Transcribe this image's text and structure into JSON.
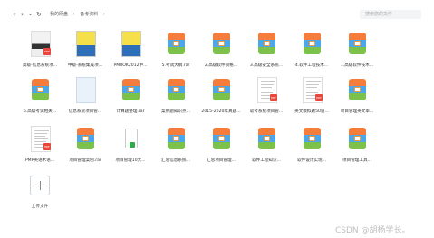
{
  "toolbar": {
    "back": "‹",
    "forward": "›",
    "dropdown": "⌄",
    "refresh": "↻",
    "breadcrumb": [
      "我的网盘",
      "›",
      "备考资料",
      "›"
    ],
    "search_placeholder": "搜索您的文件"
  },
  "files": [
    {
      "label": "高级-信息系统项...",
      "kind": "photo"
    },
    {
      "label": "中级-系统集成项...",
      "kind": "cover-blue"
    },
    {
      "label": "PMBOK2012中...",
      "kind": "cover-blue"
    },
    {
      "label": "5.考试大纲.rar",
      "kind": "archive"
    },
    {
      "label": "2.高级软件资格...",
      "kind": "archive"
    },
    {
      "label": "3.高级安全系统...",
      "kind": "archive"
    },
    {
      "label": "4.软件工程技术...",
      "kind": "archive"
    },
    {
      "label": "1.高级软件技术...",
      "kind": "archive"
    },
    {
      "label": "6.高级考试相关...",
      "kind": "archive"
    },
    {
      "label": "信息系统项目管...",
      "kind": "doc-blue"
    },
    {
      "label": "计算题整理.rar",
      "kind": "archive"
    },
    {
      "label": "案例题知识点...",
      "kind": "archive"
    },
    {
      "label": "2015-2020年真题...",
      "kind": "archive"
    },
    {
      "label": "软考系统项目管...",
      "kind": "pdf"
    },
    {
      "label": "英文模拟题50道...",
      "kind": "pdf"
    },
    {
      "label": "项目管理英文单...",
      "kind": "archive"
    },
    {
      "label": "PMP英语术语...",
      "kind": "pdf"
    },
    {
      "label": "项目管理案例.rar",
      "kind": "archive"
    },
    {
      "label": "项目管理10大...",
      "kind": "xls"
    },
    {
      "label": "汇总信息系统...",
      "kind": "archive"
    },
    {
      "label": "汇总项目管理...",
      "kind": "archive"
    },
    {
      "label": "软件工程知识...",
      "kind": "archive"
    },
    {
      "label": "软件设计实现...",
      "kind": "archive"
    },
    {
      "label": "项目管理工具...",
      "kind": "archive"
    }
  ],
  "upload_label": "上传文件",
  "watermark": "CSDN @胡杨学长。"
}
